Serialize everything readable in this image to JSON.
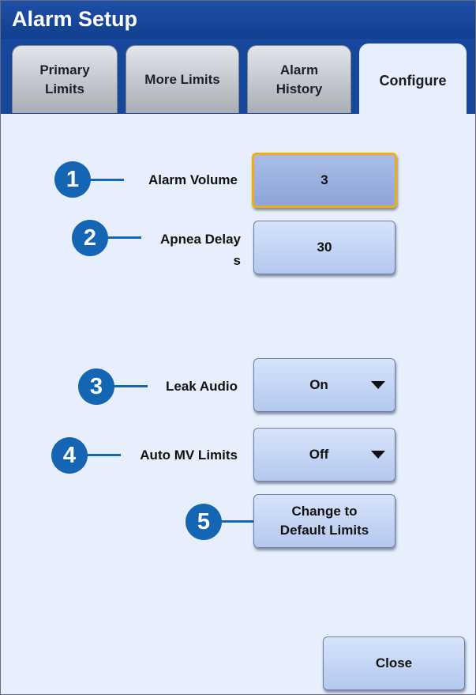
{
  "window": {
    "title": "Alarm Setup"
  },
  "tabs": [
    {
      "line1": "Primary",
      "line2": "Limits"
    },
    {
      "line1": "More Limits",
      "line2": ""
    },
    {
      "line1": "Alarm",
      "line2": "History"
    },
    {
      "line1": "Configure",
      "line2": ""
    }
  ],
  "active_tab": "Configure",
  "settings": {
    "alarm_volume": {
      "badge": "1",
      "label": "Alarm Volume",
      "value": "3"
    },
    "apnea_delay": {
      "badge": "2",
      "label_line1": "Apnea Delay",
      "label_line2": "s",
      "value": "30"
    },
    "leak_audio": {
      "badge": "3",
      "label": "Leak Audio",
      "value": "On"
    },
    "auto_mv_limits": {
      "badge": "4",
      "label": "Auto MV Limits",
      "value": "Off"
    },
    "default_limits": {
      "badge": "5",
      "line1": "Change to",
      "line2": "Default Limits"
    }
  },
  "close_label": "Close",
  "colors": {
    "accent": "#1565b5",
    "title_bar": "#17479c",
    "selected_border": "#f0ac16",
    "panel": "#e7effc"
  }
}
